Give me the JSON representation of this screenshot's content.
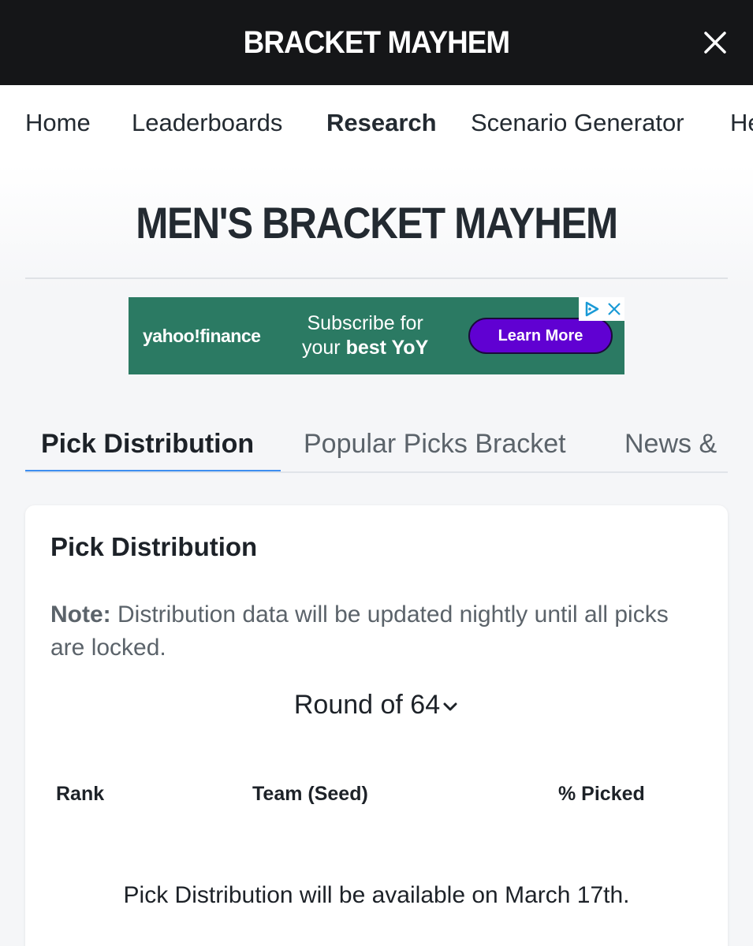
{
  "header": {
    "brand": "BRACKET MAYHEM",
    "close_icon": "close-icon"
  },
  "nav": {
    "items": [
      {
        "label": "Home",
        "active": false
      },
      {
        "label": "Leaderboards",
        "active": false
      },
      {
        "label": "Research",
        "active": true
      },
      {
        "label": "Scenario Generator",
        "active": false
      },
      {
        "label": "He",
        "active": false
      }
    ]
  },
  "page": {
    "title": "MEN'S BRACKET MAYHEM"
  },
  "ad": {
    "logo": "yahoo!finance",
    "line1": "Subscribe for",
    "line2_prefix": "your ",
    "line2_bold": "best YoY",
    "cta": "Learn More",
    "adchoices_icon": "adchoices-icon",
    "close_icon": "close-icon",
    "background": "#2b7a63",
    "cta_color": "#6001d2"
  },
  "tabs": [
    {
      "label": "Pick Distribution",
      "active": true
    },
    {
      "label": "Popular Picks Bracket",
      "active": false
    },
    {
      "label": "News &",
      "active": false
    }
  ],
  "card": {
    "title": "Pick Distribution",
    "note_label": "Note:",
    "note_text": " Distribution data will be updated nightly until all picks are locked.",
    "round_select": "Round of 64",
    "columns": [
      "Rank",
      "Team (Seed)",
      "% Picked"
    ],
    "empty_message": "Pick Distribution will be available on March 17th."
  },
  "colors": {
    "topbar": "#151618",
    "accent": "#3d8ef0"
  }
}
